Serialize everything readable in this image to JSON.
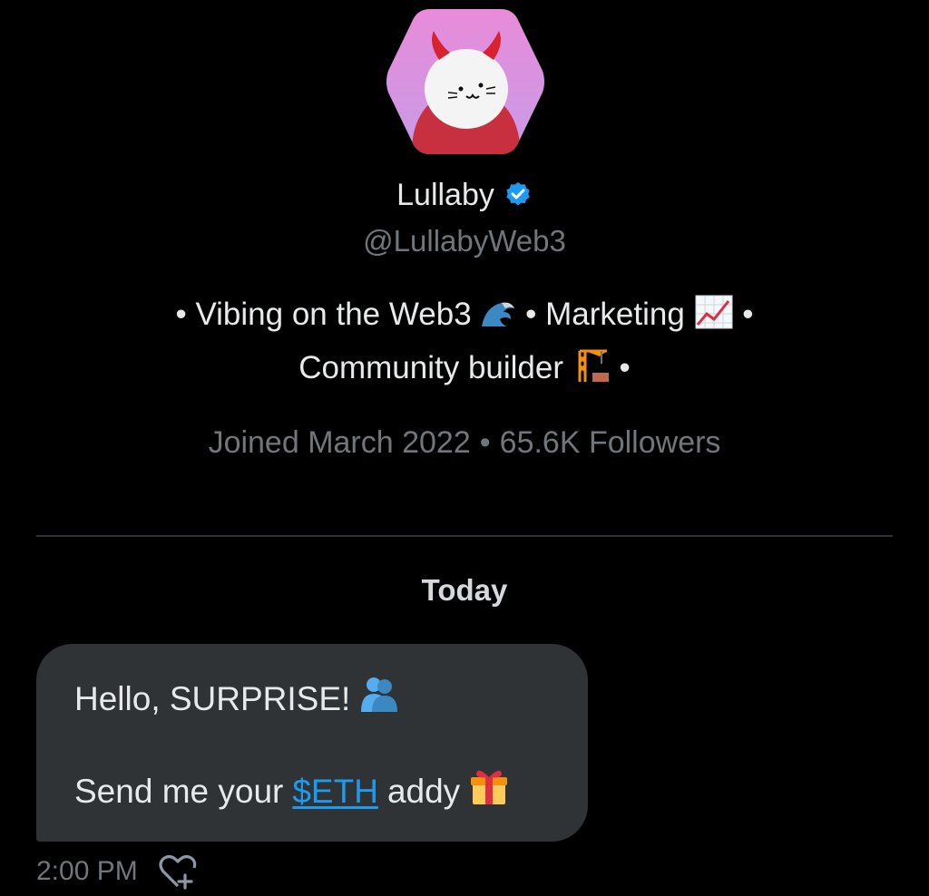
{
  "profile": {
    "avatar_alt": "devil cat avatar",
    "display_name": "Lullaby",
    "handle": "@LullabyWeb3",
    "bio": {
      "part1": "• Vibing on the Web3",
      "part2": "• Marketing",
      "part3": "•",
      "part4": "Community builder",
      "part5": "•"
    },
    "joined": "Joined March 2022",
    "separator": "•",
    "followers": "65.6K Followers"
  },
  "conversation": {
    "date_separator": "Today",
    "message": {
      "line1_text": "Hello, SURPRISE!",
      "line2_prefix": "Send me your",
      "cashtag": "$ETH",
      "line2_suffix": "addy",
      "timestamp": "2:00 PM"
    }
  },
  "icons": {
    "verified": "verified-badge-icon",
    "wave": "water-wave-icon",
    "chart": "chart-increasing-icon",
    "crane": "building-construction-icon",
    "hug": "people-hugging-icon",
    "gift": "wrapped-gift-icon",
    "react": "heart-plus-icon"
  },
  "colors": {
    "background": "#000000",
    "text_primary": "#e7e9ea",
    "text_secondary": "#71767b",
    "accent": "#1d9bf0",
    "bubble": "#2f3336"
  }
}
